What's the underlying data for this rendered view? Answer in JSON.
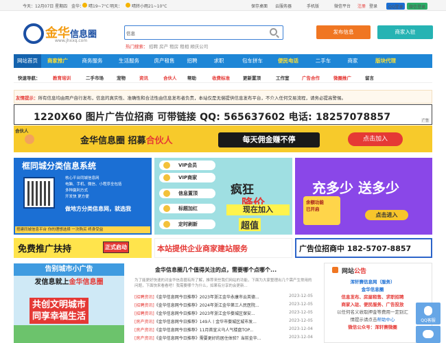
{
  "topbar": {
    "today": "今天：12月07日 星期四",
    "city": "金华：",
    "w1": "晴19~7°C",
    "w1_sep": "明天：",
    "w2": "晴转小雨21~10°C",
    "links": [
      "保存桌面",
      "云服务器",
      "手机版",
      "微信平台"
    ],
    "register": "注册",
    "login": "登录",
    "qq_login": "QQ登录",
    "wx_login": "微信登录",
    "accent_qq": "#1b6fd4",
    "accent_wx": "#2aae67"
  },
  "header": {
    "logo_text": "金华",
    "logo_text2": "信息圈",
    "logo_url": "www.jhxxq.com",
    "search_select": "信息",
    "hot_label": "热门搜索：",
    "hot_words": "招聘 房产 租房 租相 顺庆公司",
    "publish_label": "发布信息",
    "merchant_label": "商家入驻"
  },
  "nav": {
    "items": [
      {
        "label": "网站首页",
        "style": "home"
      },
      {
        "label": "商家推广",
        "style": "hl"
      },
      {
        "label": "商务服务",
        "style": ""
      },
      {
        "label": "生活服务",
        "style": ""
      },
      {
        "label": "房产租售",
        "style": ""
      },
      {
        "label": "招聘",
        "style": ""
      },
      {
        "label": "求职",
        "style": ""
      },
      {
        "label": "包车拼车",
        "style": ""
      },
      {
        "label": "便民电话",
        "style": "hl"
      },
      {
        "label": "二手车",
        "style": ""
      },
      {
        "label": "商家",
        "style": ""
      },
      {
        "label": "版块代理",
        "style": "hl"
      }
    ]
  },
  "quick": {
    "label": "快速导航：",
    "items": [
      {
        "label": "教育培训",
        "red": true
      },
      {
        "label": "二手市场",
        "red": false
      },
      {
        "label": "宠物",
        "red": false
      },
      {
        "label": "资讯",
        "red": true
      },
      {
        "label": "合伙人",
        "red": true
      },
      {
        "label": "帮助",
        "red": false
      },
      {
        "label": "收费标准",
        "red": true
      },
      {
        "label": "更新置顶",
        "red": false
      },
      {
        "label": "工作室",
        "red": false
      },
      {
        "label": "广告合作",
        "red": true
      },
      {
        "label": "微圈推广",
        "red": true
      },
      {
        "label": "留言",
        "red": false
      }
    ]
  },
  "notice": {
    "label": "友情提示：",
    "text": "所有信息均由用户自行发布，信息的真实性、准确性和合法性由信息发布者负责，本站仅是无偿提供信息发布平台，不介入任何交易流程，请务必提高警惕。"
  },
  "banner1": {
    "text": "1220X60  图片广告位招商  可带链接 QQ: 565637602 电话: 18257078857",
    "tag": "广告"
  },
  "banner2": {
    "hehuo": "合伙人",
    "brand": "金华信息圈",
    "slogan1": "招募",
    "slogan2": "合伙人",
    "middle": "每天佣金赚不停",
    "button": "点击加入",
    "bg": "#f7ca2b"
  },
  "ad_a": {
    "title": "框同城分类信息系统",
    "lines": "核心平台同城信息网\n电脑、手机、微信、小程序全包括\n多种赢利方式\n开发快 更方便",
    "big": "做地方分类信息网，就选我",
    "foot": "搭建同城信息平台 你的理想选择 一次购买 终身受益"
  },
  "ad_b": {
    "pills": [
      "VIP会员",
      "VIP商家",
      "信息置顶",
      "标题加红",
      "定时刷新"
    ],
    "big1": "疯狂",
    "big2": "降价",
    "join": "现在加入",
    "chaozhi": "超值"
  },
  "ad_c": {
    "big": "充多少 送多少",
    "chart": "余额功能\n已开启",
    "btn": "点击进入"
  },
  "strips": {
    "a_text": "免费推广扶持",
    "a_tag": "正式启动",
    "b_text": "本站提供企业商家建站服务",
    "c_text": "广告位招商中 182-5707-8857"
  },
  "pic_ad": {
    "top": "告别城市小广告",
    "sub1": "发信息就上",
    "sub2": "金华信息圈",
    "big": "共创文明城市\n同享幸福生活"
  },
  "news": {
    "title": "金华信息圈几个值得关注的点，需要哪个点哪个...",
    "desc": "为了能更好快速的对金华信息圈有所了解，推荐来些我们网站的功能，下面为大家整理出几个需产生常用的问题，下面快来看看吧！我需要哪个为什么，如果有分享的会更新...",
    "rows": [
      {
        "cat": "[招聘资讯]",
        "title": "《金华信息网今日推荐》2023年浙江金华永康市云英德...",
        "date": "2023-12-05"
      },
      {
        "cat": "[招聘资讯]",
        "title": "《金华信息网今日推荐》2024年浙江金华第三人民医院...",
        "date": "2023-12-05"
      },
      {
        "cat": "[招聘资讯]",
        "title": "《金华信息网今日推荐》2023年浙江金华婺城区保安...",
        "date": "2023-12-05"
      },
      {
        "cat": "[房产资讯]",
        "title": "《金华信息网今日推荐》149人丨金华市婺城区城市发...",
        "date": "2023-12-05"
      },
      {
        "cat": "[房产资讯]",
        "title": "《金华信息网今日推荐》11月首宣义乌人气楼盘TOP...",
        "date": "2023-12-04"
      },
      {
        "cat": "[房产资讯]",
        "title": "《金华信息网今日推荐》需要更好的居住体验？当前金华...",
        "date": "2023-12-04"
      }
    ]
  },
  "notice_panel": {
    "title1": "网站",
    "title2": "公告",
    "l1": "浑轩赛信息网（服务）",
    "l2": "金华信息圈",
    "l3": "信息发布、房屋租售、求职招聘",
    "l4": "商家入驻、便民服务、广告投放",
    "l5": "以任何名义收取押金等费用一定别汇",
    "l6": "情提示请点击",
    "l6b": "帮助中心",
    "l7": "微信公众号：浑轩赛微圈"
  },
  "floats": {
    "qq": "QQ客服"
  }
}
